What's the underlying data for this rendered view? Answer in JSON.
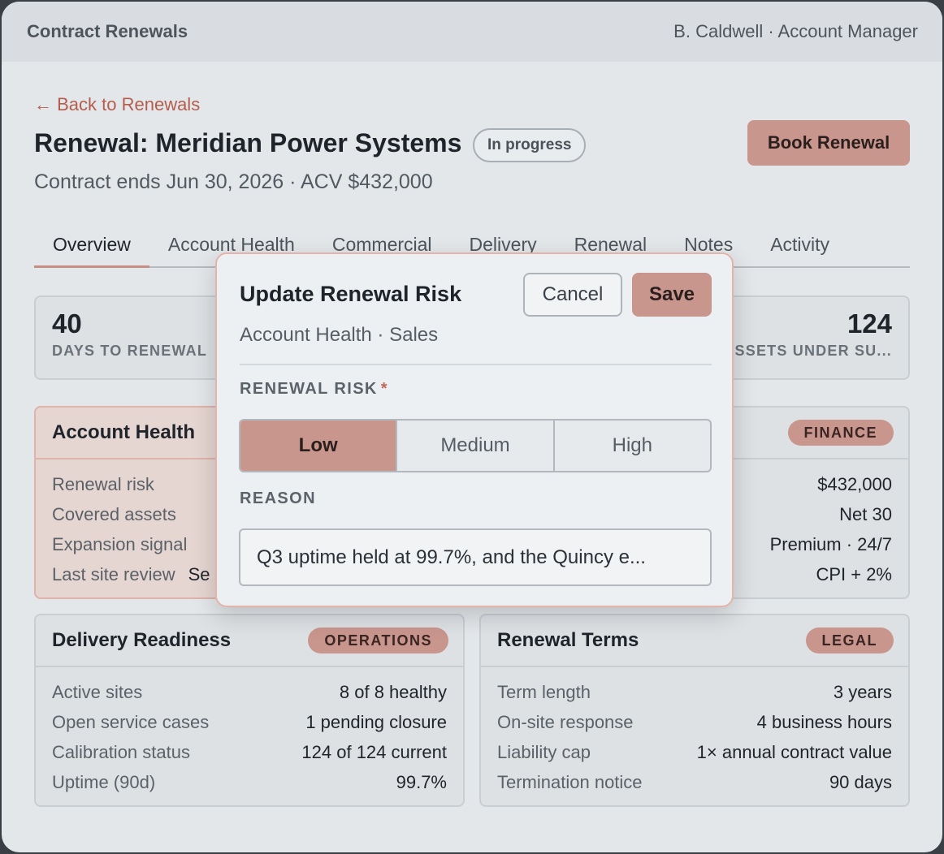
{
  "topbar": {
    "app_title": "Contract Renewals",
    "user": "B. Caldwell · Account Manager"
  },
  "header": {
    "back_link": "← Back to Renewals",
    "title": "Renewal: Meridian Power Systems",
    "status": "In progress",
    "book_button": "Book Renewal",
    "subtitle": "Contract ends Jun 30, 2026 · ACV $432,000"
  },
  "tabs": [
    "Overview",
    "Account Health",
    "Commercial",
    "Delivery",
    "Renewal",
    "Notes",
    "Activity"
  ],
  "active_tab": "Overview",
  "stats": [
    {
      "value": "40",
      "label": "DAYS TO RENEWAL"
    },
    {
      "value": "124",
      "label": "ASSETS UNDER SU..."
    }
  ],
  "cards": {
    "account_health": {
      "title": "Account Health",
      "rows": [
        {
          "key": "Renewal risk",
          "value": ""
        },
        {
          "key": "Covered assets",
          "value": ""
        },
        {
          "key": "Expansion signal",
          "value": ""
        },
        {
          "key": "Last site review",
          "value": "Se"
        }
      ]
    },
    "commercial": {
      "tag": "FINANCE",
      "rows": [
        {
          "key": "",
          "value": "$432,000"
        },
        {
          "key": "",
          "value": "Net 30"
        },
        {
          "key": "",
          "value": "Premium · 24/7"
        },
        {
          "key": "",
          "value": "CPI + 2%"
        }
      ]
    },
    "delivery": {
      "title": "Delivery Readiness",
      "tag": "OPERATIONS",
      "rows": [
        {
          "key": "Active sites",
          "value": "8 of 8 healthy"
        },
        {
          "key": "Open service cases",
          "value": "1 pending closure"
        },
        {
          "key": "Calibration status",
          "value": "124 of 124 current"
        },
        {
          "key": "Uptime (90d)",
          "value": "99.7%"
        }
      ]
    },
    "terms": {
      "title": "Renewal Terms",
      "tag": "LEGAL",
      "rows": [
        {
          "key": "Term length",
          "value": "3 years"
        },
        {
          "key": "On-site response",
          "value": "4 business hours"
        },
        {
          "key": "Liability cap",
          "value": "1× annual contract value"
        },
        {
          "key": "Termination notice",
          "value": "90 days"
        }
      ]
    }
  },
  "dialog": {
    "title": "Update Renewal Risk",
    "context": "Account Health · Sales",
    "cancel": "Cancel",
    "save": "Save",
    "risk_label": "RENEWAL RISK",
    "required_mark": "*",
    "options": [
      "Low",
      "Medium",
      "High"
    ],
    "selected": "Low",
    "reason_label": "REASON",
    "reason_value": "Q3 uptime held at 99.7%, and the Quincy e..."
  },
  "colors": {
    "accent": "#c9968e",
    "link": "#b55d4c",
    "health_card_bg": "#e6d6d2"
  }
}
